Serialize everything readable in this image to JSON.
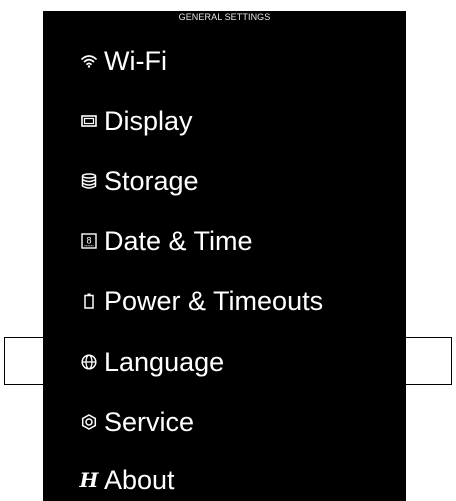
{
  "header": {
    "title": "GENERAL SETTINGS"
  },
  "menu": {
    "items": [
      {
        "label": "Wi-Fi",
        "icon": "wifi-icon"
      },
      {
        "label": "Display",
        "icon": "display-icon"
      },
      {
        "label": "Storage",
        "icon": "storage-icon"
      },
      {
        "label": "Date & Time",
        "icon": "calendar-icon",
        "icon_text": "8"
      },
      {
        "label": "Power & Timeouts",
        "icon": "battery-icon"
      },
      {
        "label": "Language",
        "icon": "globe-icon",
        "selected": true
      },
      {
        "label": "Service",
        "icon": "service-icon"
      },
      {
        "label": "About",
        "icon": "about-icon",
        "icon_text": "H"
      }
    ]
  },
  "colors": {
    "background": "#000000",
    "text": "#ffffff",
    "page": "#ffffff",
    "selection_border": "#000000"
  }
}
